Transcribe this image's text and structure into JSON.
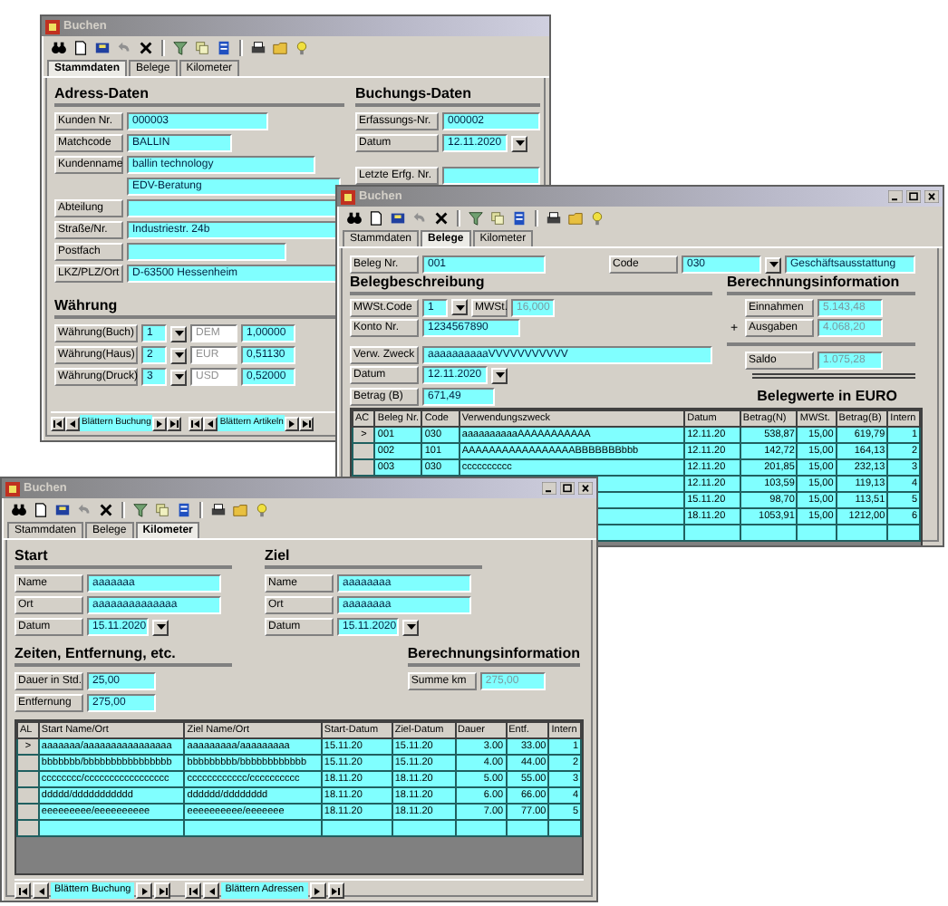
{
  "window_stammdaten": {
    "title": "Buchen",
    "tabs": [
      {
        "label": "Stammdaten",
        "selected": true
      },
      {
        "label": "Belege",
        "selected": false
      },
      {
        "label": "Kilometer",
        "selected": false
      }
    ],
    "address": {
      "heading": "Adress-Daten",
      "fields": [
        {
          "label": "Kunden Nr.",
          "value": "000003"
        },
        {
          "label": "Matchcode",
          "value": "BALLIN"
        },
        {
          "label": "Kundenname",
          "value": "ballin technology"
        },
        {
          "value": "EDV-Beratung"
        },
        {
          "label": "Abteilung"
        },
        {
          "label": "Straße/Nr.",
          "value": "Industriestr. 24b"
        },
        {
          "label": "Postfach"
        },
        {
          "label": "LKZ/PLZ/Ort",
          "value": "D-63500 Hessenheim"
        }
      ]
    },
    "currency": {
      "heading": "Währung",
      "rows": [
        {
          "label": "Währung(Buch)",
          "code": "1",
          "name": "DEM",
          "rate": "1,00000"
        },
        {
          "label": "Währung(Haus)",
          "code": "2",
          "name": "EUR",
          "rate": "0,51130"
        },
        {
          "label": "Währung(Druck)",
          "code": "3",
          "name": "USD",
          "rate": "0,52000"
        }
      ]
    },
    "booking": {
      "heading": "Buchungs-Daten",
      "fields": [
        {
          "label": "Erfassungs-Nr.",
          "value": "000002",
          "kind": "text"
        },
        {
          "label": "Datum",
          "value": "12.11.2020",
          "kind": "dropdown"
        },
        {
          "label": "Letzte Erfg. Nr.",
          "kind": "text"
        }
      ]
    },
    "navigators": [
      {
        "label": "Blättern Buchung"
      },
      {
        "label": "Blättern Artikeln"
      }
    ]
  },
  "window_belege": {
    "title": "Buchen",
    "tabs": [
      {
        "label": "Stammdaten",
        "selected": false
      },
      {
        "label": "Belege",
        "selected": true
      },
      {
        "label": "Kilometer",
        "selected": false
      }
    ],
    "beleg_nr": {
      "label": "Beleg Nr.",
      "value": "001"
    },
    "code": {
      "label": "Code",
      "value": "030",
      "description": "Geschäftsausstattung"
    },
    "description": {
      "heading": "Belegbeschreibung",
      "vat_code": {
        "label": "MWSt.Code",
        "value": "1"
      },
      "vat": {
        "label": "MWSt.",
        "value": "16,000",
        "disabled": true
      },
      "fields": [
        {
          "label": "Konto Nr.",
          "value": "1234567890",
          "kind": "text"
        },
        {
          "label": "Verw. Zweck",
          "value": "aaaaaaaaaaVVVVVVVVVVV",
          "kind": "text"
        },
        {
          "label": "Datum",
          "value": "12.11.2020",
          "kind": "dropdown"
        },
        {
          "label": "Betrag (B)",
          "value": "671,49",
          "kind": "text"
        }
      ]
    },
    "calculation": {
      "heading": "Berechnungsinformation",
      "rows": [
        {
          "label": "Einnahmen",
          "value": "5.143,48",
          "disabled": true
        },
        {
          "sign": "+",
          "label": "Ausgaben",
          "value": "4.068,20",
          "disabled": true
        },
        {
          "label": "Saldo",
          "value": "1.075,28",
          "disabled": true
        }
      ]
    },
    "values": {
      "heading": "Belegwerte in EURO",
      "columns": [
        "AC",
        "Beleg Nr.",
        "Code",
        "Verwendungszweck",
        "Datum",
        "Betrag(N)",
        "MWSt.",
        "Betrag(B)",
        "Intern"
      ],
      "rows": [
        {
          "cells": [
            ">",
            "001",
            "030",
            "aaaaaaaaaaAAAAAAAAAAA",
            "12.11.20",
            "538,87",
            "15,00",
            "619,79",
            "1"
          ]
        },
        {
          "cells": [
            null,
            "002",
            "101",
            "AAAAAAAAAAAAAAAAABBBBBBBbbb",
            "12.11.20",
            "142,72",
            "15,00",
            "164,13",
            "2"
          ]
        },
        {
          "cells": [
            null,
            "003",
            "030",
            "cccccccccc",
            "12.11.20",
            "201,85",
            "15,00",
            "232,13",
            "3"
          ]
        },
        {
          "cells": [
            null,
            null,
            null,
            null,
            "12.11.20",
            "103,59",
            "15,00",
            "119,13",
            "4"
          ]
        },
        {
          "cells": [
            null,
            null,
            null,
            null,
            "15.11.20",
            "98,70",
            "15,00",
            "113,51",
            "5"
          ]
        },
        {
          "cells": [
            null,
            null,
            null,
            null,
            "18.11.20",
            "1053,91",
            "15,00",
            "1212,00",
            "6"
          ]
        }
      ]
    }
  },
  "window_kilometer": {
    "title": "Buchen",
    "tabs": [
      {
        "label": "Stammdaten",
        "selected": false
      },
      {
        "label": "Belege",
        "selected": false
      },
      {
        "label": "Kilometer",
        "selected": true
      }
    ],
    "start": {
      "heading": "Start",
      "fields": [
        {
          "label": "Name",
          "value": "aaaaaaa",
          "kind": "text"
        },
        {
          "label": "Ort",
          "value": "aaaaaaaaaaaaaa",
          "kind": "text"
        },
        {
          "label": "Datum",
          "value": "15.11.2020",
          "kind": "dropdown"
        }
      ]
    },
    "destination": {
      "heading": "Ziel",
      "fields": [
        {
          "label": "Name",
          "value": "aaaaaaaa",
          "kind": "text"
        },
        {
          "label": "Ort",
          "value": "aaaaaaaa",
          "kind": "text"
        },
        {
          "label": "Datum",
          "value": "15.11.2020",
          "kind": "dropdown"
        }
      ]
    },
    "times": {
      "heading": "Zeiten, Entfernung, etc.",
      "fields": [
        {
          "label": "Dauer in Std.",
          "value": "25,00"
        },
        {
          "label": "Entfernung",
          "value": "275,00"
        }
      ]
    },
    "calculation": {
      "heading": "Berechnungsinformation",
      "fields": [
        {
          "label": "Summe km",
          "value": "275,00",
          "disabled": true
        }
      ]
    },
    "trips": {
      "columns": [
        "AL",
        "Start Name/Ort",
        "Ziel Name/Ort",
        "Start-Datum",
        "Ziel-Datum",
        "Dauer",
        "Entf.",
        "Intern"
      ],
      "rows": [
        {
          "cells": [
            ">",
            "aaaaaaa/aaaaaaaaaaaaaaaa",
            "aaaaaaaaa/aaaaaaaaa",
            "15.11.20",
            "15.11.20",
            "3.00",
            "33.00",
            "1"
          ]
        },
        {
          "cells": [
            null,
            "bbbbbbb/bbbbbbbbbbbbbbbb",
            "bbbbbbbbb/bbbbbbbbbbbb",
            "15.11.20",
            "15.11.20",
            "4.00",
            "44.00",
            "2"
          ]
        },
        {
          "cells": [
            null,
            "cccccccc/ccccccccccccccccc",
            "cccccccccccc/cccccccccc",
            "18.11.20",
            "18.11.20",
            "5.00",
            "55.00",
            "3"
          ]
        },
        {
          "cells": [
            null,
            "ddddd/ddddddddddd",
            "dddddd/dddddddd",
            "18.11.20",
            "18.11.20",
            "6.00",
            "66.00",
            "4"
          ]
        },
        {
          "cells": [
            null,
            "eeeeeeeee/eeeeeeeeee",
            "eeeeeeeeee/eeeeeee",
            "18.11.20",
            "18.11.20",
            "7.00",
            "77.00",
            "5"
          ]
        }
      ]
    },
    "navigators": [
      {
        "label": "Blättern Buchung"
      },
      {
        "label": "Blättern Adressen"
      }
    ]
  }
}
